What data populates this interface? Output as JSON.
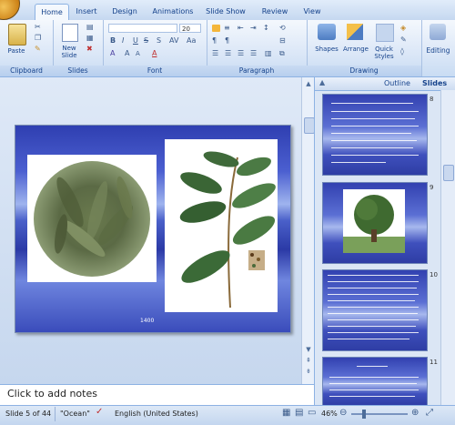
{
  "tabs": [
    {
      "label": "Home",
      "active": true
    },
    {
      "label": "Insert",
      "active": false
    },
    {
      "label": "Design",
      "active": false
    },
    {
      "label": "Animations",
      "active": false
    },
    {
      "label": "Slide Show",
      "active": false
    },
    {
      "label": "Review",
      "active": false
    },
    {
      "label": "View",
      "active": false
    }
  ],
  "ribbon": {
    "clipboard": {
      "paste_label": "Paste",
      "group_label": "Clipboard"
    },
    "slides": {
      "new_slide_label": "New Slide",
      "group_label": "Slides"
    },
    "font": {
      "font_name": "",
      "font_size": "20",
      "group_label": "Font"
    },
    "paragraph": {
      "group_label": "Paragraph"
    },
    "drawing": {
      "shapes_label": "Shapes",
      "arrange_label": "Arrange",
      "quick_styles_label": "Quick Styles",
      "group_label": "Drawing"
    },
    "editing": {
      "editing_label": "Editing"
    }
  },
  "slide": {
    "footer_number": "1400"
  },
  "notes": {
    "placeholder": "Click to add notes"
  },
  "panel": {
    "tabs": [
      {
        "label": "Outline"
      },
      {
        "label": "Slides"
      }
    ],
    "thumbnails": [
      {
        "number": "8"
      },
      {
        "number": "9"
      },
      {
        "number": "10"
      },
      {
        "number": "11"
      }
    ]
  },
  "status": {
    "slide_info": "Slide 5 of 44",
    "theme": "\"Ocean\"",
    "language": "English (United States)",
    "zoom": "46%"
  },
  "colors": {
    "accent": "#15428b",
    "slide_blue": "#2f3fb1",
    "ribbon_bg": "#dbe7f7"
  }
}
